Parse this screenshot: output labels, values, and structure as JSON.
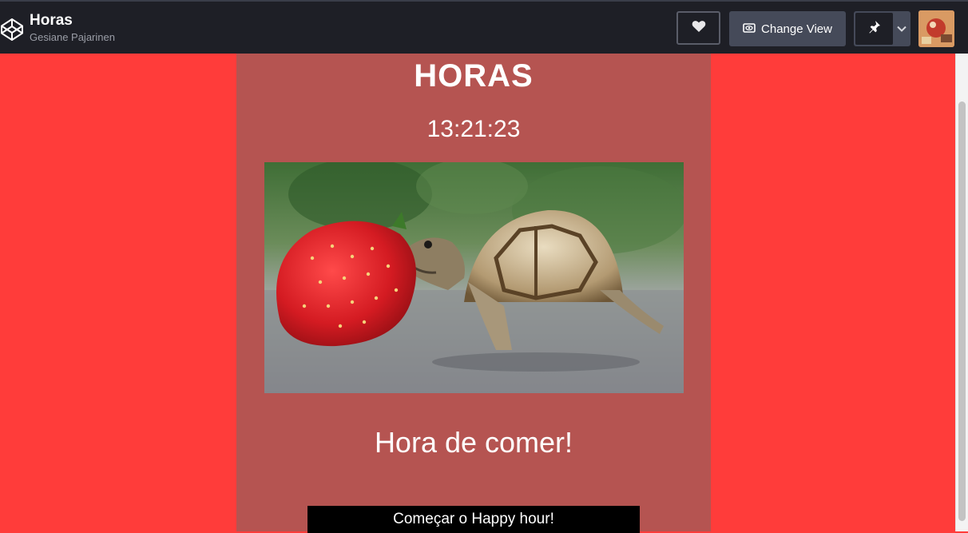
{
  "header": {
    "title": "Horas",
    "author": "Gesiane Pajarinen",
    "change_view_label": "Change View",
    "icons": [
      "codepen-logo-icon",
      "heart-icon",
      "eye-icon",
      "pin-icon",
      "chevron-down-icon"
    ]
  },
  "content": {
    "heading": "HORAS",
    "clock": "13:21:23",
    "image_subject": "turtle-eating-strawberry",
    "caption": "Hora de comer!",
    "happy_hour_button": "Começar o Happy hour!"
  },
  "colors": {
    "page_background": "#ff3c3a",
    "panel_background": "#b55451",
    "topbar_background": "#1e1f26",
    "button_black": "#000000"
  }
}
